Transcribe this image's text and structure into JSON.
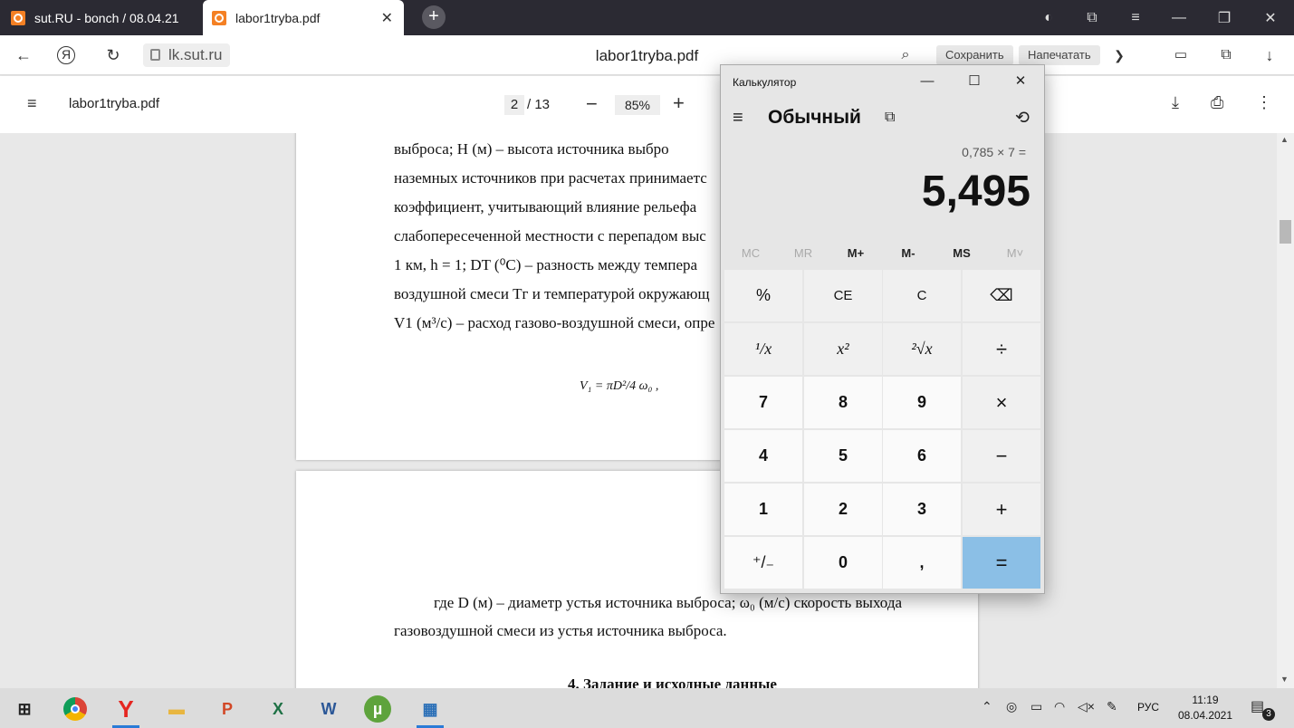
{
  "browser": {
    "tabs": [
      {
        "label": "sut.RU - bonch / 08.04.21"
      },
      {
        "label": "labor1tryba.pdf"
      }
    ],
    "url": "lk.sut.ru",
    "page_title": "labor1tryba.pdf",
    "save_label": "Сохранить",
    "print_label": "Напечатать"
  },
  "pdf_viewer": {
    "file_name": "labor1tryba.pdf",
    "current_page": "2",
    "total_pages": "/ 13",
    "zoom": "85%"
  },
  "document": {
    "page1_lines": [
      "выброса;  H  (м)  –  высота  источника  выбро",
      "наземных источников при расчетах принимаетс",
      "коэффициент, учитывающий влияние рельефа",
      "слабопересеченной местности с перепадом выс",
      "1  км,  h  =  1;  DT (⁰С)  –  разность между темпера",
      "воздушной смеси  Tг и температурой окружающ",
      "V1 (м³/с) – расход газово-воздушной смеси, опре"
    ],
    "formula": "V₁ = πD²/4 ω₀ ,",
    "page2_lines": [
      "где  D (м) – диаметр устья источника выброса; ω₀ (м/с) скорость выхода",
      "газовоздушной смеси из устья источника выброса."
    ],
    "section_heading": "4. Задание и исходные данные"
  },
  "calculator": {
    "title": "Калькулятор",
    "mode": "Обычный",
    "expression": "0,785 × 7 =",
    "result": "5,495",
    "memory_buttons": [
      "MC",
      "MR",
      "M+",
      "M-",
      "MS",
      "M˅"
    ],
    "keys": [
      [
        "%",
        "CE",
        "C",
        "⌫"
      ],
      [
        "¹/x",
        "x²",
        "²√x",
        "÷"
      ],
      [
        "7",
        "8",
        "9",
        "×"
      ],
      [
        "4",
        "5",
        "6",
        "−"
      ],
      [
        "1",
        "2",
        "3",
        "+"
      ],
      [
        "⁺/₋",
        "0",
        ",",
        "="
      ]
    ]
  },
  "taskbar": {
    "language": "РУС",
    "time": "11:19",
    "date": "08.04.2021",
    "notification_count": "3"
  },
  "colors": {
    "tabbar": "#2b2a33",
    "equals_key": "#8bbfe6",
    "taskbar": "#dcdcdc"
  }
}
